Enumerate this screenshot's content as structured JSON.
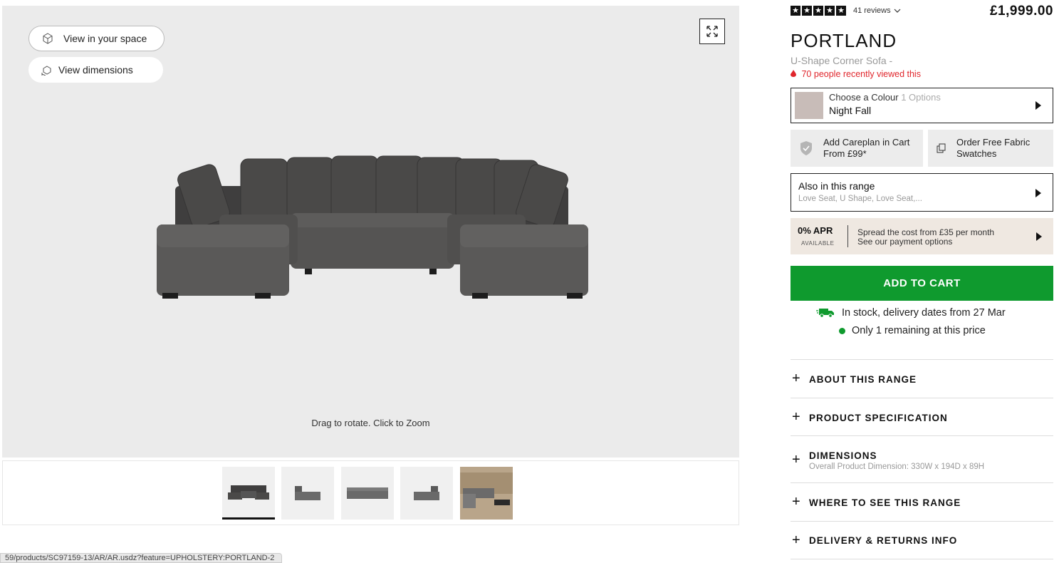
{
  "viewer": {
    "view_in_space": "View in your space",
    "view_dimensions": "View dimensions",
    "hint": "Drag to rotate. Click to Zoom"
  },
  "status_url": "59/products/SC97159-13/AR/AR.usdz?feature=UPHOLSTERY:PORTLAND-2",
  "product": {
    "reviews": "41 reviews",
    "price": "£1,999.00",
    "name": "PORTLAND",
    "subtitle": "U-Shape Corner Sofa -",
    "viewed": "70 people recently viewed this",
    "colour_label": "Choose a Colour",
    "colour_options": "1 Options",
    "colour_value": "Night Fall",
    "colour_swatch": "#c8bcb8",
    "careplan_line1": "Add Careplan in Cart",
    "careplan_line2": "From £99*",
    "swatches_line1": "Order Free Fabric",
    "swatches_line2": "Swatches",
    "range_label": "Also in this range",
    "range_items": "Love Seat, U Shape, Love Seat,...",
    "apr_big": "0% APR",
    "apr_small": "AVAILABLE",
    "apr_line1": "Spread the cost from £35 per month",
    "apr_line2": "See our payment options",
    "add_to_cart": "ADD TO CART",
    "stock": "In stock, delivery dates from 27 Mar",
    "remaining": "Only 1 remaining at this price"
  },
  "accordion": [
    {
      "title": "ABOUT THIS RANGE"
    },
    {
      "title": "PRODUCT SPECIFICATION"
    },
    {
      "title": "DIMENSIONS",
      "detail": "Overall Product Dimension: 330W x 194D x 89H"
    },
    {
      "title": "WHERE TO SEE THIS RANGE"
    },
    {
      "title": "DELIVERY & RETURNS INFO"
    }
  ],
  "colors": {
    "accent_green": "#0f9a2e",
    "alert_red": "#e0262c",
    "apr_bg": "#efe8e1"
  }
}
